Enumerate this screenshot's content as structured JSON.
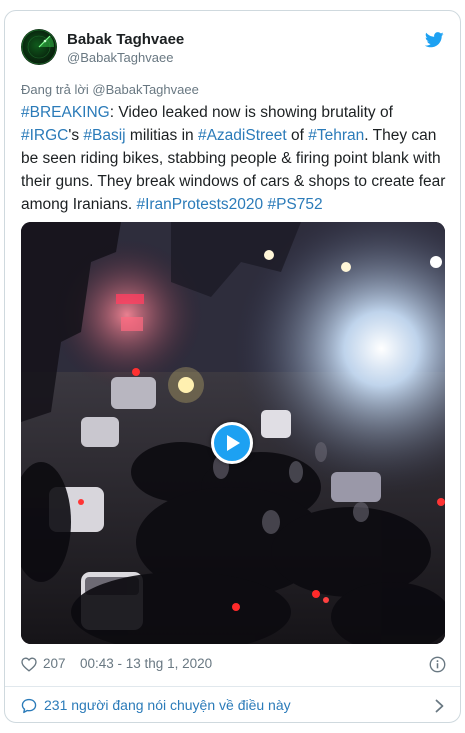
{
  "author": {
    "display_name": "Babak Taghvaee",
    "handle": "@BabakTaghvaee"
  },
  "reply_to": "Đang trả lời @BabakTaghvaee",
  "tweet": {
    "segments": [
      {
        "text": "#BREAKING",
        "link": true
      },
      {
        "text": ": Video leaked now is showing brutality of ",
        "link": false
      },
      {
        "text": "#IRGC",
        "link": true
      },
      {
        "text": "'s ",
        "link": false
      },
      {
        "text": "#Basij",
        "link": true
      },
      {
        "text": " militias in ",
        "link": false
      },
      {
        "text": "#AzadiStreet",
        "link": true
      },
      {
        "text": " of ",
        "link": false
      },
      {
        "text": "#Tehran",
        "link": true
      },
      {
        "text": ". They can be seen riding bikes, stabbing people & firing point blank with their guns. They break windows of cars & shops to create fear among Iranians. ",
        "link": false
      },
      {
        "text": "#IranProtests2020",
        "link": true
      },
      {
        "text": " ",
        "link": false
      },
      {
        "text": "#PS752",
        "link": true
      }
    ]
  },
  "media": {
    "type": "video",
    "play_icon": "play-icon"
  },
  "footer": {
    "like_count": "207",
    "timestamp": "00:43 - 13 thg 1, 2020",
    "conversation_label": "231 người đang nói chuyện về điều này"
  },
  "colors": {
    "link": "#2b7bb9",
    "brand": "#1da1f2",
    "muted": "#697882"
  },
  "icons": [
    "twitter-bird-icon",
    "heart-icon",
    "info-icon",
    "speech-bubble-icon",
    "chevron-right-icon",
    "play-icon"
  ]
}
